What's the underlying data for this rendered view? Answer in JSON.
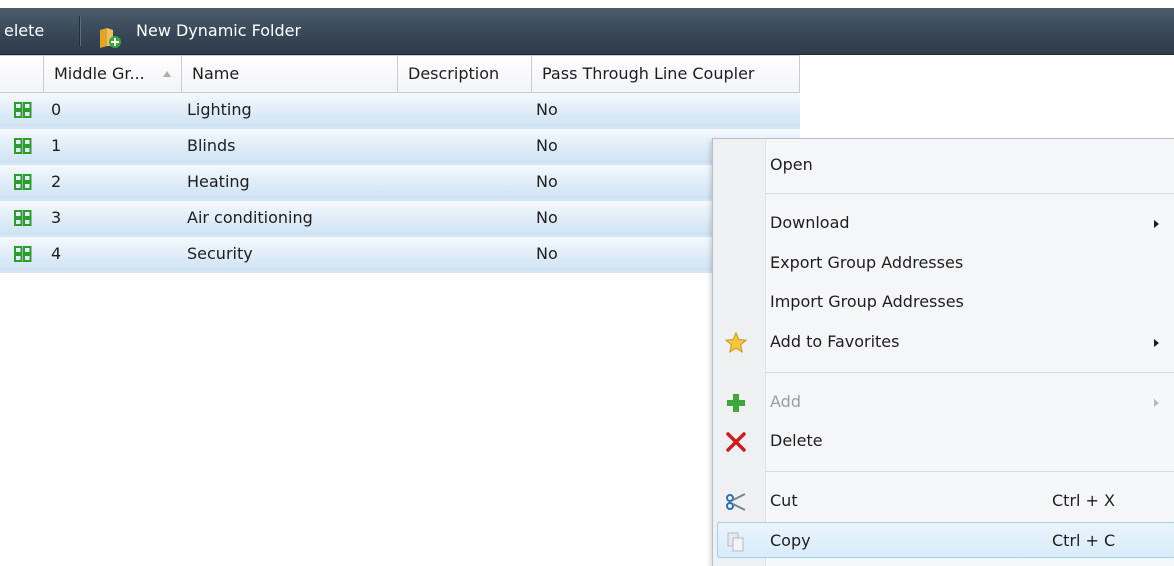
{
  "toolbar": {
    "delete_label": "elete",
    "new_dynamic_folder_label": "New Dynamic Folder"
  },
  "grid": {
    "columns": [
      "Middle Gr...",
      "Name",
      "Description",
      "Pass Through Line Coupler"
    ],
    "rows": [
      {
        "number": "0",
        "name": "Lighting",
        "description": "",
        "pass_through": "No"
      },
      {
        "number": "1",
        "name": "Blinds",
        "description": "",
        "pass_through": "No"
      },
      {
        "number": "2",
        "name": "Heating",
        "description": "",
        "pass_through": "No"
      },
      {
        "number": "3",
        "name": "Air conditioning",
        "description": "",
        "pass_through": "No"
      },
      {
        "number": "4",
        "name": "Security",
        "description": "",
        "pass_through": "No"
      }
    ]
  },
  "context_menu": {
    "open": "Open",
    "download": "Download",
    "export_group_addresses": "Export Group Addresses",
    "import_group_addresses": "Import Group Addresses",
    "add_to_favorites": "Add to Favorites",
    "add": "Add",
    "delete": "Delete",
    "cut": "Cut",
    "cut_shortcut": "Ctrl + X",
    "copy": "Copy",
    "copy_shortcut": "Ctrl + C"
  },
  "colors": {
    "toolbar_bg": "#394858",
    "row_selected": "#dbe9f7",
    "grid_icon_green": "#2e9b2e",
    "delete_red": "#cc1d1d",
    "hover_blue": "#d9ebf9"
  }
}
